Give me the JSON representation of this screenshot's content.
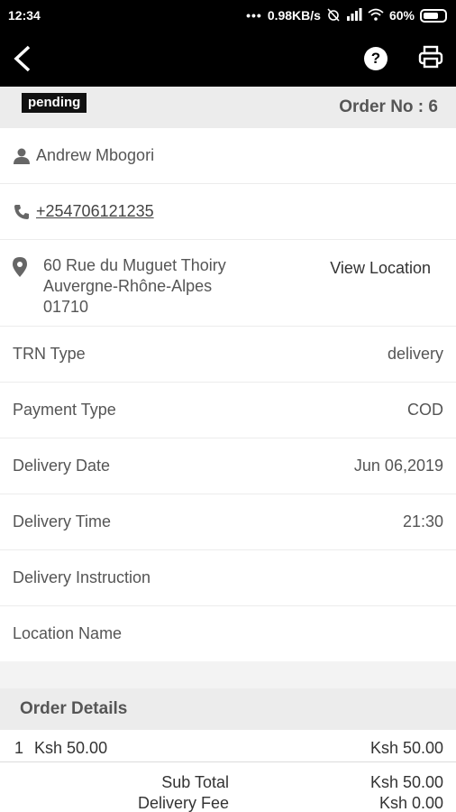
{
  "status_bar": {
    "time": "12:34",
    "network_speed": "0.98KB/s",
    "battery": "60%"
  },
  "app_bar": {
    "back_icon": "chevron-left-icon",
    "help_icon": "help-icon",
    "print_icon": "printer-icon"
  },
  "order": {
    "status": "pending",
    "order_no": "Order No : 6"
  },
  "customer": {
    "name": "Andrew Mbogori",
    "phone": "+254706121235",
    "address_line1": "60 Rue du Muguet Thoiry",
    "address_line2": "Auvergne-Rhône-Alpes",
    "address_line3": "01710",
    "view_location": "View Location"
  },
  "fields": [
    {
      "label": "TRN Type",
      "value": "delivery"
    },
    {
      "label": "Payment Type",
      "value": "COD"
    },
    {
      "label": "Delivery Date",
      "value": "Jun 06,2019"
    },
    {
      "label": "Delivery Time",
      "value": "21:30"
    },
    {
      "label": "Delivery Instruction",
      "value": ""
    },
    {
      "label": "Location Name",
      "value": ""
    }
  ],
  "order_details": {
    "title": "Order Details",
    "items": [
      {
        "qty": "1",
        "price": "Ksh 50.00",
        "total": "Ksh 50.00"
      }
    ],
    "sub_total_label": "Sub Total",
    "sub_total": "Ksh 50.00",
    "delivery_fee_label": "Delivery Fee",
    "delivery_fee": "Ksh 0.00"
  }
}
